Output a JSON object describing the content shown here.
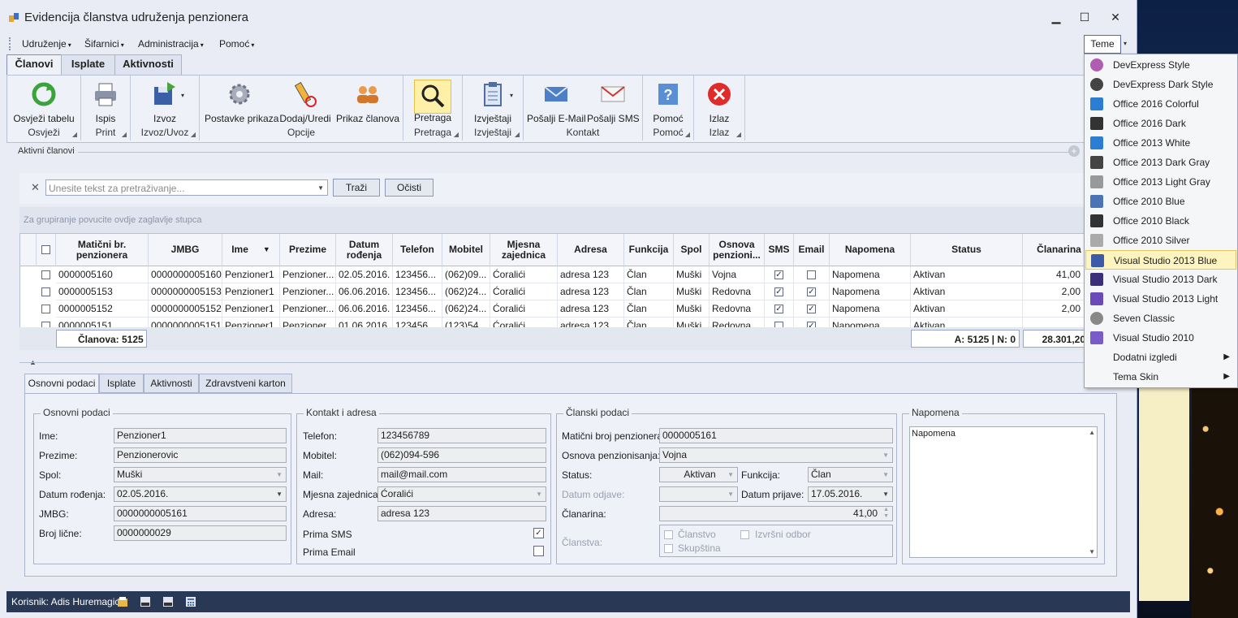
{
  "window": {
    "title": "Evidencija članstva udruženja penzionera",
    "min": "▁",
    "max": "☐",
    "close": "✕"
  },
  "menu": [
    "Udruženje",
    "Šifarnici",
    "Administracija",
    "Pomoć"
  ],
  "theme_button": "Teme",
  "tabs": [
    "Članovi",
    "Isplate",
    "Aktivnosti"
  ],
  "ribbon": {
    "osvjezi": {
      "label": "Osvježi tabelu",
      "group": "Osvježi"
    },
    "ispis": {
      "label": "Ispis",
      "group": "Print"
    },
    "izvoz": {
      "label": "Izvoz",
      "group": "Izvoz/Uvoz"
    },
    "postavke": {
      "label": "Postavke prikaza"
    },
    "dodaj": {
      "label": "Dodaj/Uredi"
    },
    "prikaz": {
      "label": "Prikaz članova",
      "group": "Opcije"
    },
    "pretraga": {
      "label": "Pretraga",
      "group": "Pretraga"
    },
    "izvjestaji": {
      "label": "Izvještaji",
      "group": "Izvještaji"
    },
    "email": {
      "label": "Pošalji E-Mail"
    },
    "sms": {
      "label": "Pošalji SMS",
      "group": "Kontakt"
    },
    "pomoc": {
      "label": "Pomoć",
      "group": "Pomoć"
    },
    "izlaz": {
      "label": "Izlaz",
      "group": "Izlaz"
    }
  },
  "panel_title": "Aktivni članovi",
  "search": {
    "placeholder": "Unesite tekst za pretraživanje...",
    "find": "Traži",
    "clear": "Očisti",
    "close": "✕"
  },
  "group_hint": "Za grupiranje povucite ovdje zaglavlje stupca",
  "grid": {
    "headers": [
      "Matični br. penzionera",
      "JMBG",
      "Ime",
      "Prezime",
      "Datum rođenja",
      "Telefon",
      "Mobitel",
      "Mjesna zajednica",
      "Adresa",
      "Funkcija",
      "Spol",
      "Osnova penzioni...",
      "SMS",
      "Email",
      "Napomena",
      "Status",
      "Članarina"
    ],
    "rows": [
      {
        "mb": "0000005160",
        "jmbg": "0000000005160",
        "ime": "Penzioner1",
        "prezime": "Penzioner...",
        "datum": "02.05.2016.",
        "tel": "123456...",
        "mob": "(062)09...",
        "mz": "Ćoralići",
        "adresa": "adresa 123",
        "funk": "Član",
        "spol": "Muški",
        "osnova": "Vojna",
        "sms": "✓",
        "email": "",
        "nap": "Napomena",
        "status": "Aktivan",
        "clan": "41,00"
      },
      {
        "mb": "0000005153",
        "jmbg": "0000000005153",
        "ime": "Penzioner1",
        "prezime": "Penzioner...",
        "datum": "06.06.2016.",
        "tel": "123456...",
        "mob": "(062)24...",
        "mz": "Ćoralići",
        "adresa": "adresa 123",
        "funk": "Član",
        "spol": "Muški",
        "osnova": "Redovna",
        "sms": "✓",
        "email": "✓",
        "nap": "Napomena",
        "status": "Aktivan",
        "clan": "2,00"
      },
      {
        "mb": "0000005152",
        "jmbg": "0000000005152",
        "ime": "Penzioner1",
        "prezime": "Penzioner...",
        "datum": "06.06.2016.",
        "tel": "123456...",
        "mob": "(062)24...",
        "mz": "Ćoralići",
        "adresa": "adresa 123",
        "funk": "Član",
        "spol": "Muški",
        "osnova": "Redovna",
        "sms": "✓",
        "email": "✓",
        "nap": "Napomena",
        "status": "Aktivan",
        "clan": "2,00"
      },
      {
        "mb": "0000005151",
        "jmbg": "0000000005151",
        "ime": "Penzioner1",
        "prezime": "Penzioner...",
        "datum": "01.06.2016.",
        "tel": "123456...",
        "mob": "(123)54...",
        "mz": "Ćoralići",
        "adresa": "adresa 123",
        "funk": "Član",
        "spol": "Muški",
        "osnova": "Redovna",
        "sms": "",
        "email": "✓",
        "nap": "Napomena",
        "status": "Aktivan",
        "clan": ""
      }
    ],
    "footer": {
      "count": "Članova: 5125",
      "status": "A: 5125 | N: 0",
      "sum": "28.301,20"
    }
  },
  "detail_tabs": [
    "Osnovni podaci",
    "Isplate",
    "Aktivnosti",
    "Zdravstveni karton"
  ],
  "osnovni": {
    "legend": "Osnovni podaci",
    "ime_lbl": "Ime:",
    "ime": "Penzioner1",
    "prezime_lbl": "Prezime:",
    "prezime": "Penzionerovic",
    "spol_lbl": "Spol:",
    "spol": "Muški",
    "datum_lbl": "Datum rođenja:",
    "datum": "02.05.2016.",
    "jmbg_lbl": "JMBG:",
    "jmbg": "0000000005161",
    "licna_lbl": "Broj lične:",
    "licna": "0000000029"
  },
  "kontakt": {
    "legend": "Kontakt i adresa",
    "tel_lbl": "Telefon:",
    "tel": "123456789",
    "mob_lbl": "Mobitel:",
    "mob": "(062)094-596",
    "mail_lbl": "Mail:",
    "mail": "mail@mail.com",
    "mz_lbl": "Mjesna zajednica:",
    "mz": "Ćoralići",
    "adresa_lbl": "Adresa:",
    "adresa": "adresa 123",
    "sms_lbl": "Prima SMS",
    "email_lbl": "Prima Email",
    "check": "✓"
  },
  "clanski": {
    "legend": "Članski podaci",
    "mb_lbl": "Matični broj penzionera:",
    "mb": "0000005161",
    "osnova_lbl": "Osnova penzionisanja:",
    "osnova": "Vojna",
    "status_lbl": "Status:",
    "status": "Aktivan",
    "funkcija_lbl": "Funkcija:",
    "funkcija": "Član",
    "odjava_lbl": "Datum odjave:",
    "prijava_lbl": "Datum prijave:",
    "prijava": "17.05.2016.",
    "clanarina_lbl": "Članarina:",
    "clanarina": "41,00",
    "clanstva_lbl": "Članstva:",
    "c1": "Članstvo",
    "c2": "Izvršni odbor",
    "c3": "Skupština"
  },
  "napomena": {
    "legend": "Napomena",
    "text": "Napomena"
  },
  "statusbar": {
    "user": "Korisnik: Adis Huremagic"
  },
  "theme_menu": [
    {
      "label": "DevExpress Style",
      "icon": "devexpress-style-icon"
    },
    {
      "label": "DevExpress Dark Style",
      "icon": "devexpress-dark-icon"
    },
    {
      "label": "Office 2016 Colorful",
      "icon": "office-2016-colorful-icon"
    },
    {
      "label": "Office 2016 Dark",
      "icon": "office-2016-dark-icon"
    },
    {
      "label": "Office 2013 White",
      "icon": "office-2013-white-icon"
    },
    {
      "label": "Office 2013 Dark Gray",
      "icon": "office-2013-dark-gray-icon"
    },
    {
      "label": "Office 2013 Light Gray",
      "icon": "office-2013-light-gray-icon"
    },
    {
      "label": "Office 2010 Blue",
      "icon": "office-2010-blue-icon"
    },
    {
      "label": "Office 2010 Black",
      "icon": "office-2010-black-icon"
    },
    {
      "label": "Office 2010 Silver",
      "icon": "office-2010-silver-icon"
    },
    {
      "label": "Visual Studio 2013 Blue",
      "icon": "vs-2013-blue-icon"
    },
    {
      "label": "Visual Studio 2013 Dark",
      "icon": "vs-2013-dark-icon"
    },
    {
      "label": "Visual Studio 2013 Light",
      "icon": "vs-2013-light-icon"
    },
    {
      "label": "Seven Classic",
      "icon": "seven-classic-icon"
    },
    {
      "label": "Visual Studio 2010",
      "icon": "vs-2010-icon"
    },
    {
      "label": "Dodatni izgledi",
      "icon": ""
    },
    {
      "label": "Tema Skin",
      "icon": ""
    }
  ],
  "theme_selected": "Visual Studio 2013 Blue",
  "colors": {
    "accent": "#293955",
    "highlight": "#fdf4bf",
    "window": "#e9ecf5"
  }
}
